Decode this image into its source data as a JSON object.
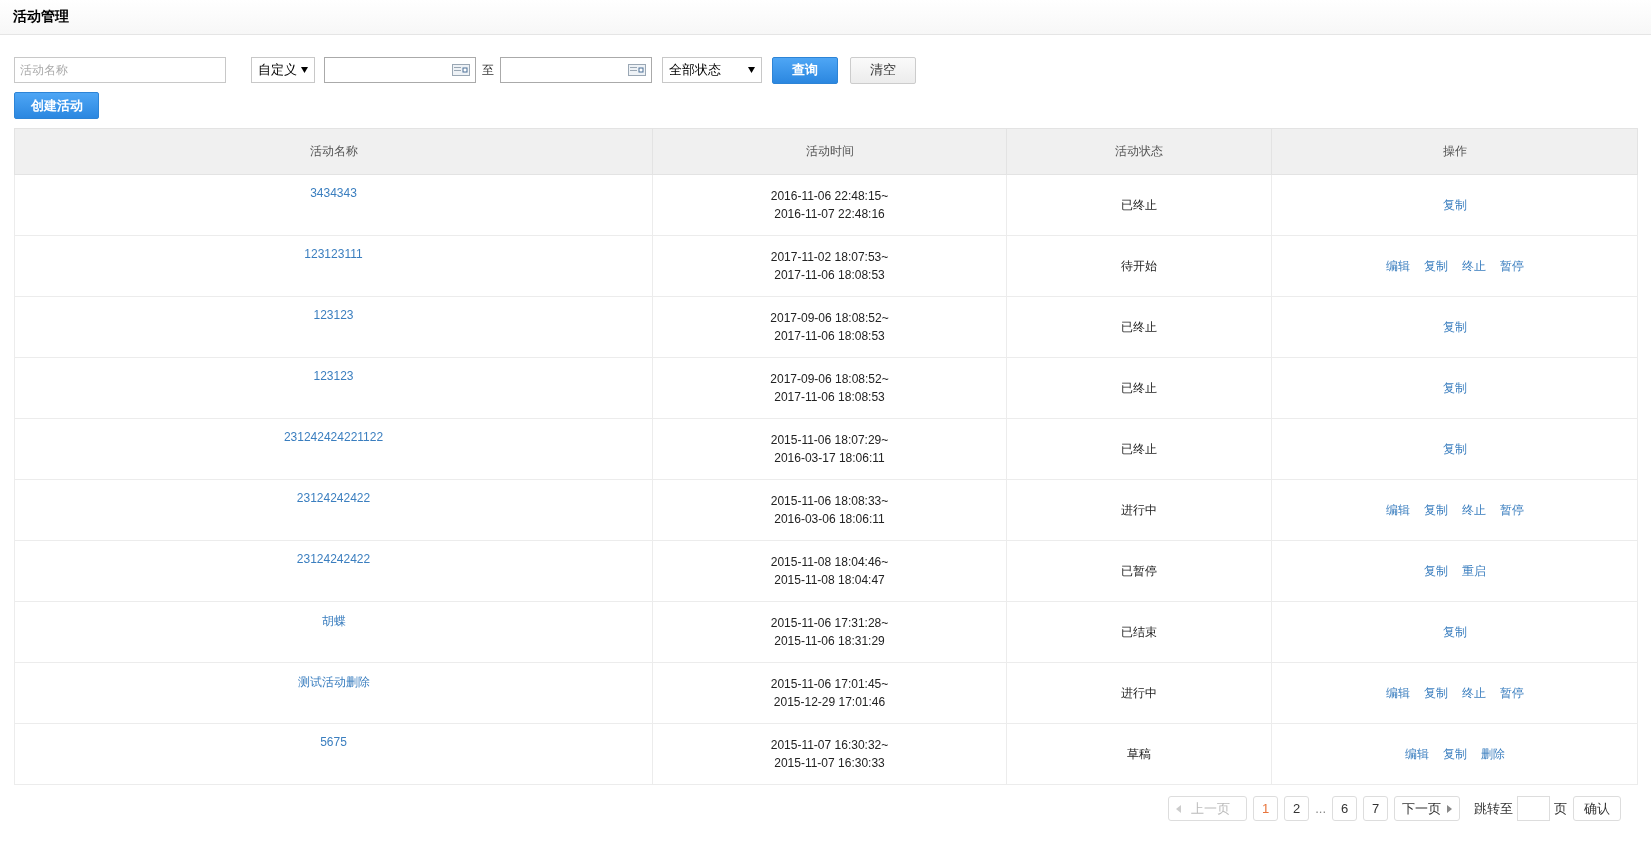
{
  "page_title": "活动管理",
  "filters": {
    "name_field": {
      "placeholder": "活动名称"
    },
    "date_mode": {
      "value": "自定义"
    },
    "date_range": {
      "separator": "至"
    },
    "status_filter": {
      "value": "全部状态"
    },
    "buttons": [
      {
        "label": "查询",
        "kind": "primary"
      },
      {
        "label": "清空",
        "kind": "default"
      }
    ]
  },
  "create_button": {
    "label": "创建活动"
  },
  "table": {
    "columns": [
      "活动名称",
      "活动时间",
      "活动状态",
      "操作"
    ],
    "rows": [
      {
        "name": "3434343",
        "time": [
          "2016-11-06 22:48:15~",
          "2016-11-07 22:48:16"
        ],
        "status": "已终止",
        "actions": [
          "复制"
        ]
      },
      {
        "name": "123123111",
        "time": [
          "2017-11-02 18:07:53~",
          "2017-11-06 18:08:53"
        ],
        "status": "待开始",
        "actions": [
          "编辑",
          "复制",
          "终止",
          "暂停"
        ]
      },
      {
        "name": "123123",
        "time": [
          "2017-09-06 18:08:52~",
          "2017-11-06 18:08:53"
        ],
        "status": "已终止",
        "actions": [
          "复制"
        ]
      },
      {
        "name": "123123",
        "time": [
          "2017-09-06 18:08:52~",
          "2017-11-06 18:08:53"
        ],
        "status": "已终止",
        "actions": [
          "复制"
        ]
      },
      {
        "name": "231242424221122",
        "time": [
          "2015-11-06 18:07:29~",
          "2016-03-17 18:06:11"
        ],
        "status": "已终止",
        "actions": [
          "复制"
        ]
      },
      {
        "name": "23124242422",
        "time": [
          "2015-11-06 18:08:33~",
          "2016-03-06 18:06:11"
        ],
        "status": "进行中",
        "actions": [
          "编辑",
          "复制",
          "终止",
          "暂停"
        ]
      },
      {
        "name": "23124242422",
        "time": [
          "2015-11-08 18:04:46~",
          "2015-11-08 18:04:47"
        ],
        "status": "已暂停",
        "actions": [
          "复制",
          "重启"
        ]
      },
      {
        "name": "胡蝶",
        "time": [
          "2015-11-06 17:31:28~",
          "2015-11-06 18:31:29"
        ],
        "status": "已结束",
        "actions": [
          "复制"
        ]
      },
      {
        "name": "测试活动删除",
        "time": [
          "2015-11-06 17:01:45~",
          "2015-12-29 17:01:46"
        ],
        "status": "进行中",
        "actions": [
          "编辑",
          "复制",
          "终止",
          "暂停"
        ]
      },
      {
        "name": "5675",
        "time": [
          "2015-11-07 16:30:32~",
          "2015-11-07 16:30:33"
        ],
        "status": "草稿",
        "actions": [
          "编辑",
          "复制",
          "删除"
        ]
      }
    ]
  },
  "pagination": {
    "prev": {
      "label": "上一页",
      "disabled": true
    },
    "pages_before": [
      {
        "label": "1",
        "selected": true
      },
      {
        "label": "2",
        "selected": false
      }
    ],
    "ellipsis": "...",
    "pages_after": [
      {
        "label": "6",
        "selected": false
      },
      {
        "label": "7",
        "selected": false
      }
    ],
    "next": {
      "label": "下一页",
      "disabled": false
    },
    "jump": {
      "label": "跳转至",
      "unit": "页",
      "button": "确认"
    }
  }
}
